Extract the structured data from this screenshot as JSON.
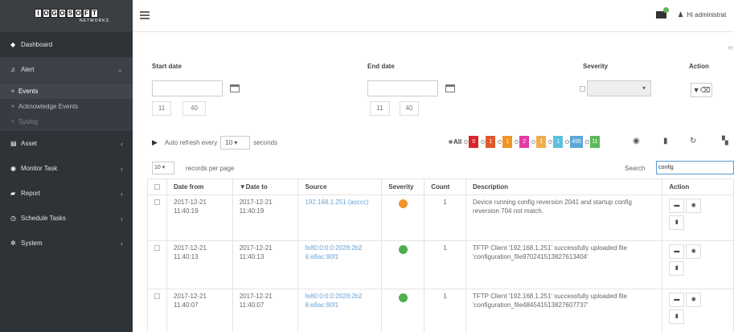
{
  "brand": {
    "letters": [
      "I",
      "O",
      "G",
      "O",
      "S",
      "O",
      "F",
      "T"
    ],
    "sub": "NETWORKS"
  },
  "sidebar": {
    "dashboard": "Dashboard",
    "alert": "Alert",
    "alert_sub": [
      "Events",
      "Acknowledge Events",
      "Syslog"
    ],
    "asset": "Asset",
    "monitor": "Monitor Task",
    "report": "Report",
    "schedule": "Schedule Tasks",
    "system": "System"
  },
  "topbar": {
    "user": "Hi administrat"
  },
  "filters": {
    "start_label": "Start date",
    "end_label": "End date",
    "severity_label": "Severity",
    "action_label": "Action",
    "start_hour": "11",
    "start_min": "40",
    "end_hour": "11",
    "end_min": "40",
    "corner": "H"
  },
  "toolbar": {
    "auto_refresh": "Auto refresh every",
    "interval": "10",
    "seconds": "seconds"
  },
  "legend": {
    "all": "All",
    "badges": [
      {
        "value": "0",
        "color": "#d9242b"
      },
      {
        "value": "1",
        "color": "#e0592a"
      },
      {
        "value": "1",
        "color": "#f29423"
      },
      {
        "value": "2",
        "color": "#e43aa7"
      },
      {
        "value": "1",
        "color": "#f0ad4e"
      },
      {
        "value": "1",
        "color": "#5bc0de"
      },
      {
        "value": "495",
        "color": "#5aa7d8"
      },
      {
        "value": "11",
        "color": "#5cb85c"
      }
    ]
  },
  "table_controls": {
    "page_len": "10",
    "per_page": "records per page",
    "search_label": "Search",
    "search_value": "config"
  },
  "table": {
    "headers": [
      "Date from",
      "▼Date to",
      "Source",
      "Severity",
      "Count",
      "Description",
      "Action"
    ],
    "rows": [
      {
        "from": "2017-12-21 11:40:19",
        "to": "2017-12-21 11:40:19",
        "source": "192.168.1.251 (asccc)",
        "severity_color": "#f0932b",
        "count": "1",
        "desc": "Device running config reversion 2041 and startup config reversion 704 not match."
      },
      {
        "from": "2017-12-21 11:40:13",
        "to": "2017-12-21 11:40:13",
        "source": "fe80:0:0:0:2028:2b2 6:e8ac:90f1",
        "severity_color": "#4cae4c",
        "count": "1",
        "desc": "TFTP Client '192.168.1.251' successfully uploaded file 'configuration_file970241513827613404'"
      },
      {
        "from": "2017-12-21 11:40:07",
        "to": "2017-12-21 11:40:07",
        "source": "fe80:0:0:0:2028:2b2 6:e8ac:90f1",
        "severity_color": "#4cae4c",
        "count": "1",
        "desc": "TFTP Client '192.168.1.251' successfully uploaded file 'configuration_file484541513827607737'"
      }
    ]
  }
}
